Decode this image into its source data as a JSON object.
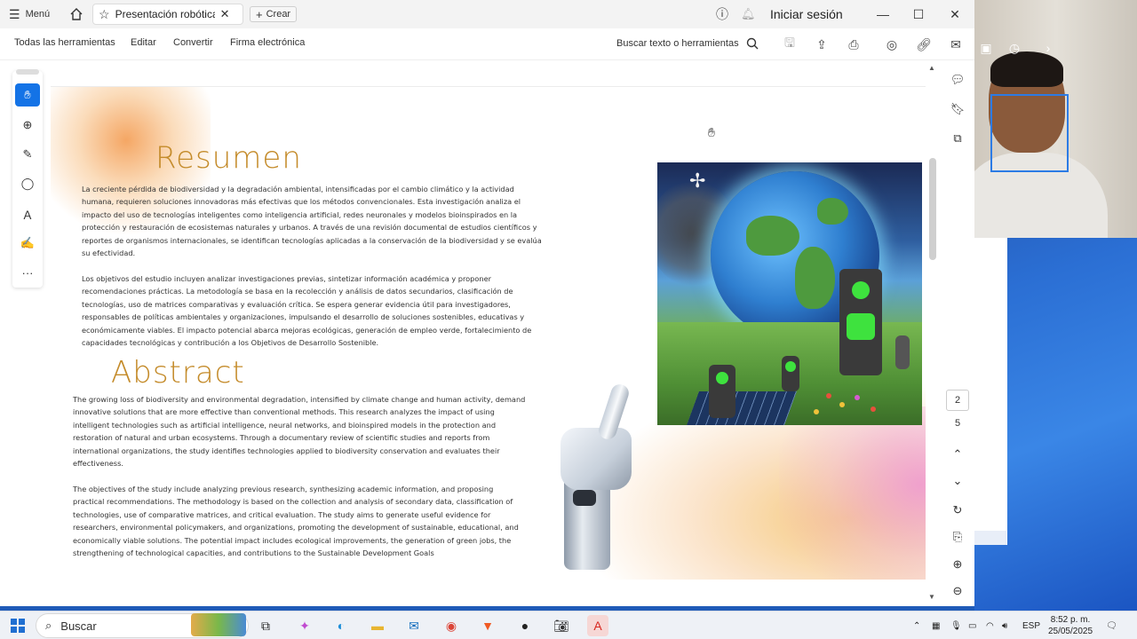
{
  "browser": {
    "menu_label": "Menú",
    "tab_title": "Presentación robótica...",
    "new_label": "Crear",
    "signin_label": "Iniciar sesión"
  },
  "toolbar": {
    "all_tools": "Todas las herramientas",
    "edit": "Editar",
    "convert": "Convertir",
    "esign": "Firma electrónica",
    "search_tools": "Buscar texto o herramientas"
  },
  "pager": {
    "current_page": "2",
    "total_pages": "5"
  },
  "document": {
    "resumen_title": "Resumen",
    "resumen_p1": "La creciente pérdida de biodiversidad y la degradación ambiental, intensificadas por el cambio climático y la actividad humana, requieren soluciones innovadoras más efectivas que los métodos convencionales. Esta investigación analiza el impacto del uso de tecnologías inteligentes como inteligencia artificial, redes neuronales y modelos bioinspirados en la protección y restauración de ecosistemas naturales y urbanos. A través de una revisión documental de estudios científicos y reportes de organismos internacionales, se identifican tecnologías aplicadas a la conservación de la biodiversidad y se evalúa su efectividad.",
    "resumen_p2": "Los objetivos del estudio incluyen analizar investigaciones previas, sintetizar información académica y proponer recomendaciones prácticas. La metodología se basa en la recolección y análisis de datos secundarios, clasificación de tecnologías, uso de matrices comparativas y evaluación crítica. Se espera generar evidencia útil para investigadores, responsables de políticas ambientales y organizaciones, impulsando el desarrollo de soluciones sostenibles, educativas y económicamente viables. El impacto potencial abarca mejoras ecológicas, generación de empleo verde, fortalecimiento de capacidades tecnológicas y contribución a los Objetivos de Desarrollo Sostenible.",
    "abstract_title": "Abstract",
    "abstract_p1": "The growing loss of biodiversity and environmental degradation, intensified by climate change and human activity, demand innovative solutions that are more effective than conventional methods. This research analyzes the impact of using intelligent technologies such as artificial intelligence, neural networks, and bioinspired models in the protection and restoration of natural and urban ecosystems. Through a documentary review of scientific studies and reports from international organizations, the study identifies technologies applied to biodiversity conservation and evaluates their effectiveness.",
    "abstract_p2": "The objectives of the study include analyzing previous research, synthesizing academic information, and proposing practical recommendations. The methodology is based on the collection and analysis of secondary data, classification of technologies, use of comparative matrices, and critical evaluation. The study aims to generate useful evidence for researchers, environmental policymakers, and organizations, promoting the development of sustainable, educational, and economically viable solutions. The potential impact includes ecological improvements, the generation of green jobs, the strengthening of technological capacities, and contributions to the Sustainable Development Goals"
  },
  "taskbar": {
    "search_label": "Buscar",
    "language": "ESP",
    "time": "8:52 p. m.",
    "date": "25/05/2025"
  },
  "colors": {
    "accent": "#1473e6",
    "heading": "#c48b2a",
    "desktop": "#1f5bb8"
  }
}
